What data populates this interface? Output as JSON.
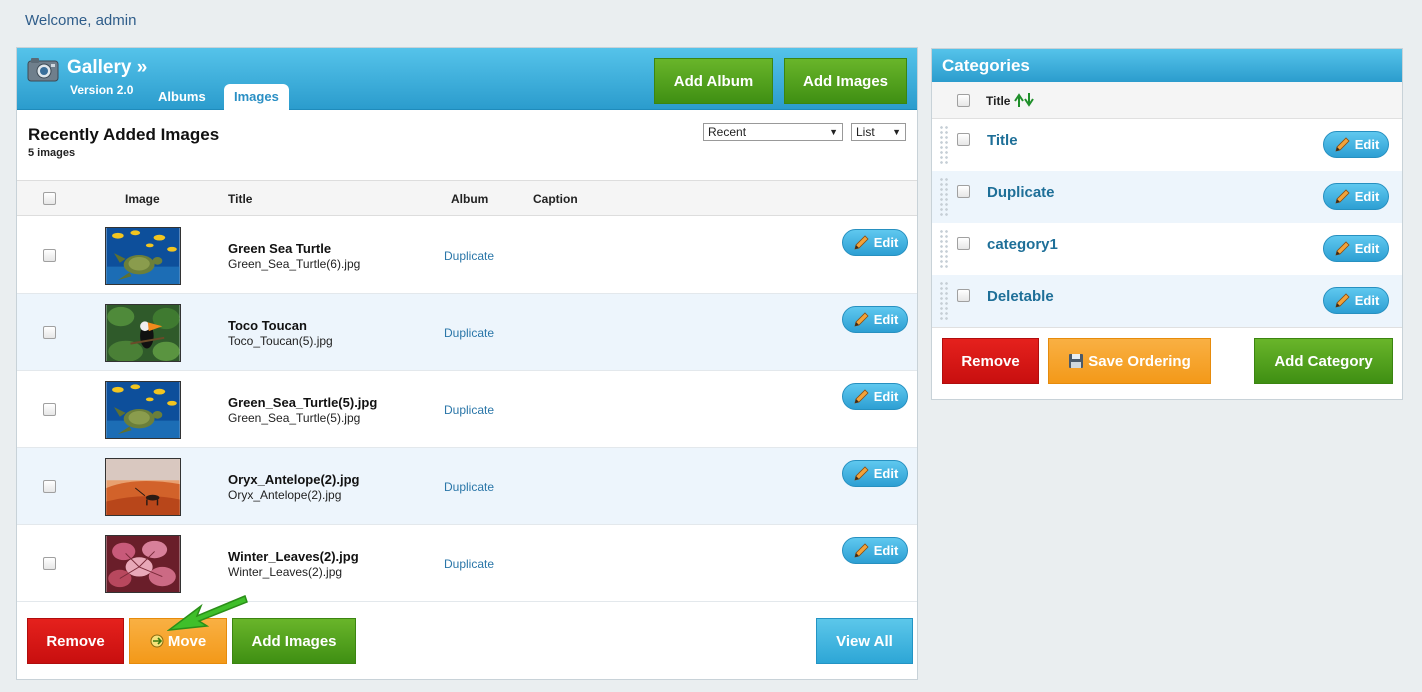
{
  "welcome": "Welcome, admin",
  "gallery": {
    "title": "Gallery »",
    "version": "Version 2.0",
    "tabs": [
      {
        "label": "Albums",
        "active": false
      },
      {
        "label": "Images",
        "active": true
      }
    ],
    "add_album_label": "Add Album",
    "add_images_label": "Add Images",
    "recent_title": "Recently Added Images",
    "recent_count": "5 images",
    "sort_select": "Recent",
    "view_select": "List",
    "columns": {
      "image": "Image",
      "title": "Title",
      "album": "Album",
      "caption": "Caption"
    },
    "rows": [
      {
        "title": "Green Sea Turtle",
        "file": "Green_Sea_Turtle(6).jpg",
        "album": "Duplicate",
        "edit": "Edit"
      },
      {
        "title": "Toco Toucan",
        "file": "Toco_Toucan(5).jpg",
        "album": "Duplicate",
        "edit": "Edit"
      },
      {
        "title": "Green_Sea_Turtle(5).jpg",
        "file": "Green_Sea_Turtle(5).jpg",
        "album": "Duplicate",
        "edit": "Edit"
      },
      {
        "title": "Oryx_Antelope(2).jpg",
        "file": "Oryx_Antelope(2).jpg",
        "album": "Duplicate",
        "edit": "Edit"
      },
      {
        "title": "Winter_Leaves(2).jpg",
        "file": "Winter_Leaves(2).jpg",
        "album": "Duplicate",
        "edit": "Edit"
      }
    ],
    "footer": {
      "remove_label": "Remove",
      "move_label": "Move",
      "add_images_label": "Add Images",
      "view_all_label": "View All"
    }
  },
  "categories": {
    "title": "Categories",
    "column_title": "Title",
    "items": [
      {
        "name": "Title",
        "edit": "Edit"
      },
      {
        "name": "Duplicate",
        "edit": "Edit"
      },
      {
        "name": "category1",
        "edit": "Edit"
      },
      {
        "name": "Deletable",
        "edit": "Edit"
      }
    ],
    "footer": {
      "remove_label": "Remove",
      "save_ordering_label": "Save Ordering",
      "add_category_label": "Add Category"
    }
  },
  "colors": {
    "header_blue": "#2b9ccd",
    "green": "#4a9a18",
    "red": "#d4161a",
    "orange": "#f5a12c",
    "link": "#2a76a8"
  },
  "icons": [
    "camera-icon",
    "pencil-icon",
    "floppy-disk-icon",
    "move-icon",
    "sort-arrows-icon",
    "pointer-arrow-icon"
  ]
}
